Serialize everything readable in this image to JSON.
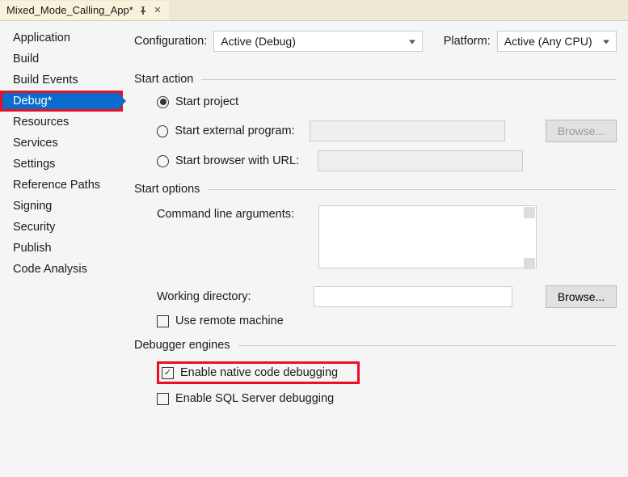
{
  "tab": {
    "title": "Mixed_Mode_Calling_App*"
  },
  "sidebar": {
    "items": [
      {
        "label": "Application"
      },
      {
        "label": "Build"
      },
      {
        "label": "Build Events"
      },
      {
        "label": "Debug*"
      },
      {
        "label": "Resources"
      },
      {
        "label": "Services"
      },
      {
        "label": "Settings"
      },
      {
        "label": "Reference Paths"
      },
      {
        "label": "Signing"
      },
      {
        "label": "Security"
      },
      {
        "label": "Publish"
      },
      {
        "label": "Code Analysis"
      }
    ],
    "selectedIndex": 3
  },
  "config": {
    "configLabel": "Configuration:",
    "configValue": "Active (Debug)",
    "platformLabel": "Platform:",
    "platformValue": "Active (Any CPU)"
  },
  "startAction": {
    "header": "Start action",
    "startProject": "Start project",
    "startExternal": "Start external program:",
    "startBrowser": "Start browser with URL:",
    "browse": "Browse..."
  },
  "startOptions": {
    "header": "Start options",
    "cmdArgs": "Command line arguments:",
    "workingDir": "Working directory:",
    "browse": "Browse...",
    "useRemote": "Use remote machine"
  },
  "debuggerEngines": {
    "header": "Debugger engines",
    "enableNative": "Enable native code debugging",
    "enableSql": "Enable SQL Server debugging"
  }
}
